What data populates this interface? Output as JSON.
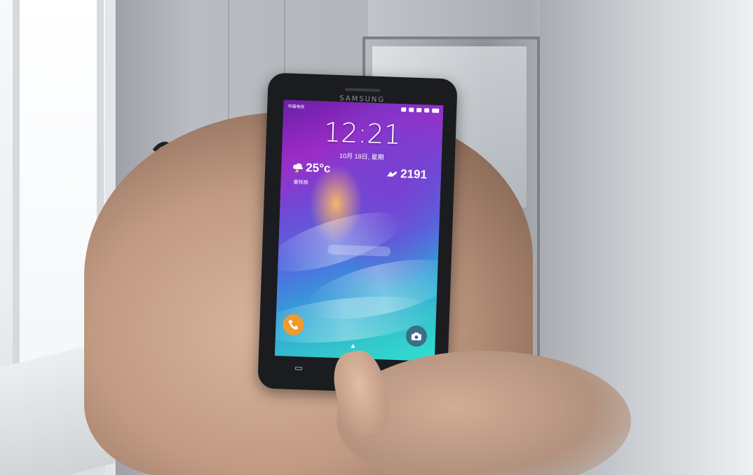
{
  "phone": {
    "brand": "SAMSUNG",
    "status_bar": {
      "carrier": "中国电信"
    },
    "lockscreen": {
      "time": "12:21",
      "date": "10月 18日, 星期",
      "weather": {
        "temperature": "25°c",
        "condition": "雷阵雨",
        "icon": "storm-cloud-icon"
      },
      "steps": {
        "value": "2191",
        "icon": "running-shoe-icon"
      },
      "shortcuts": [
        {
          "name": "phone",
          "icon": "phone-icon",
          "color": "#f09a2b"
        },
        {
          "name": "camera",
          "icon": "camera-icon",
          "color": "#3b6f86"
        }
      ]
    },
    "nav_keys": [
      "recent-apps-icon",
      "home-button",
      "back-icon"
    ]
  }
}
